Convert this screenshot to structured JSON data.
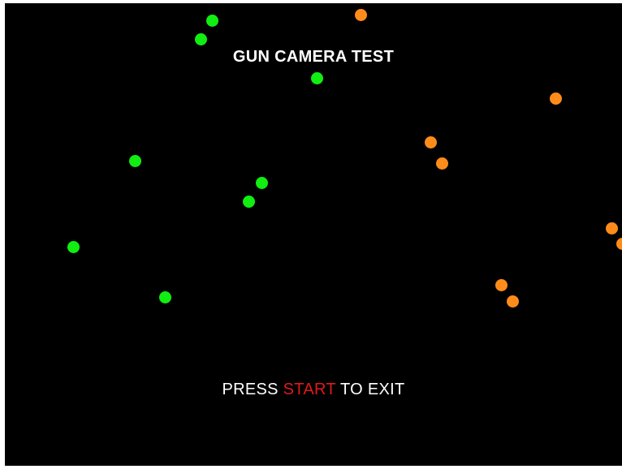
{
  "screen": {
    "title": "GUN CAMERA TEST",
    "prompt": {
      "before": "PRESS ",
      "key": "START",
      "after": " TO EXIT"
    }
  },
  "colors": {
    "background": "#000000",
    "text": "#ffffff",
    "start_key": "#e0191b",
    "player1_dot": "#11ee11",
    "player2_dot": "#ff8c1a"
  }
}
